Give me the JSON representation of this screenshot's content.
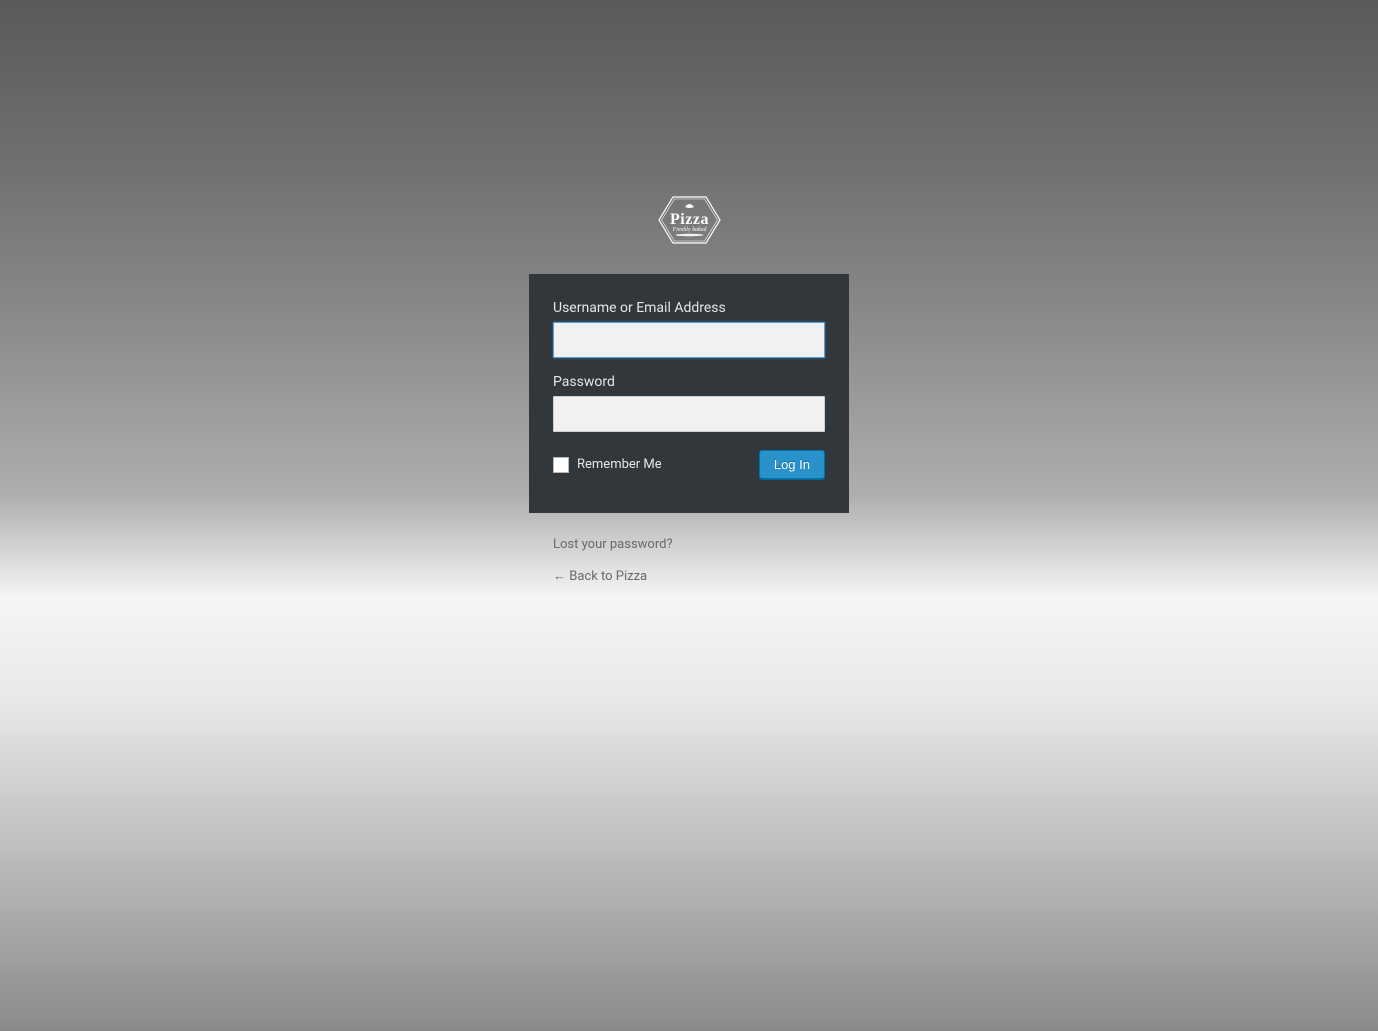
{
  "logo": {
    "main_text": "Pizza",
    "sub_text": "Freshly baked"
  },
  "form": {
    "username_label": "Username or Email Address",
    "username_value": "",
    "password_label": "Password",
    "password_value": "",
    "remember_label": "Remember Me",
    "submit_label": "Log In"
  },
  "nav": {
    "lost_password": "Lost your password?",
    "back_link": "← Back to Pizza"
  },
  "colors": {
    "form_bg": "#32373c",
    "button_bg": "#2a92ca",
    "text_light": "#e5e5e5",
    "link_muted": "#676a6d"
  }
}
